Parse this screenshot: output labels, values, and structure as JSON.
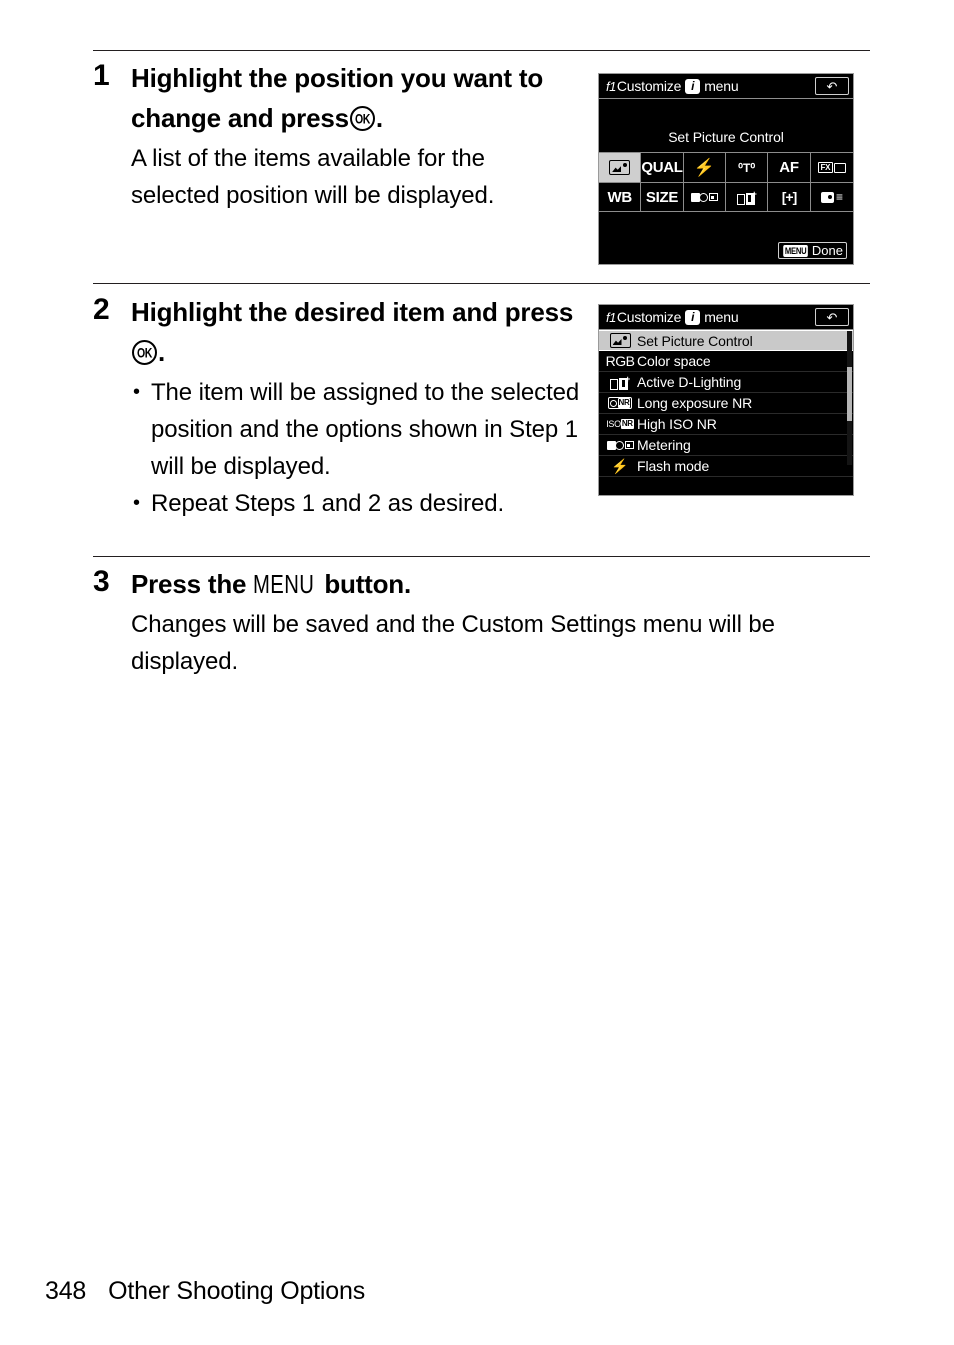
{
  "document": {
    "footer": {
      "page_number": "348",
      "section_title": "Other Shooting Options"
    }
  },
  "steps": [
    {
      "number": "1",
      "heading_part1": "Highlight the position you want to change and press",
      "heading_icon": "ok-button-icon",
      "heading_part2": ".",
      "body": "A list of the items available for the selected position will be displayed."
    },
    {
      "number": "2",
      "heading_part1": "Highlight the desired item and press",
      "heading_icon": "ok-button-icon",
      "heading_part2": ".",
      "bullets": [
        "The item will be assigned to the selected position and the options shown in Step 1 will be displayed.",
        "Repeat Steps 1 and 2 as desired."
      ]
    },
    {
      "number": "3",
      "heading_part1": "Press the",
      "heading_menu_word": "MENU",
      "heading_part2": "button.",
      "body": "Changes will be saved and the Custom Settings menu will be displayed."
    }
  ],
  "screens": {
    "screen1": {
      "header": {
        "bank": "f1",
        "title_before": "Customize",
        "badge": "i",
        "title_after": "menu",
        "back_icon": "↶"
      },
      "selected_item_title": "Set Picture Control",
      "grid_row1": [
        {
          "label": "",
          "icon": "picture-control-icon",
          "selected": true
        },
        {
          "label": "QUAL",
          "icon": "",
          "selected": false
        },
        {
          "label": "",
          "icon": "flash-icon",
          "selected": false
        },
        {
          "label": "",
          "icon": "bluetooth-icon",
          "selected": false
        },
        {
          "label": "AF",
          "icon": "",
          "selected": false
        },
        {
          "label": "",
          "icon": "fx-crop-icon",
          "selected": false
        }
      ],
      "grid_row2": [
        {
          "label": "WB",
          "icon": "",
          "selected": false
        },
        {
          "label": "SIZE",
          "icon": "",
          "selected": false
        },
        {
          "label": "",
          "icon": "metering-icon",
          "selected": false
        },
        {
          "label": "",
          "icon": "active-d-lighting-icon",
          "selected": false
        },
        {
          "label": "[+]",
          "icon": "af-area-icon",
          "selected": false
        },
        {
          "label": "",
          "icon": "custom-menu-icon",
          "selected": false
        }
      ],
      "footer_badge": {
        "chip": "MENU",
        "label": "Done"
      }
    },
    "screen2": {
      "header": {
        "bank": "f1",
        "title_before": "Customize",
        "badge": "i",
        "title_after": "menu",
        "back_icon": "↶"
      },
      "items": [
        {
          "icon": "picture-control-icon",
          "icon_text": "",
          "label": "Set Picture Control",
          "selected": true
        },
        {
          "icon": "rgb-icon",
          "icon_text": "RGB",
          "label": "Color space",
          "selected": false
        },
        {
          "icon": "active-d-lighting-icon",
          "icon_text": "",
          "label": "Active D-Lighting",
          "selected": false
        },
        {
          "icon": "long-exposure-nr-icon",
          "icon_text": "",
          "label": "Long exposure NR",
          "selected": false
        },
        {
          "icon": "high-iso-nr-icon",
          "icon_text": "",
          "label": "High ISO NR",
          "selected": false
        },
        {
          "icon": "metering-icon",
          "icon_text": "",
          "label": "Metering",
          "selected": false
        },
        {
          "icon": "flash-mode-icon",
          "icon_text": "",
          "label": "Flash mode",
          "selected": false
        }
      ]
    }
  }
}
